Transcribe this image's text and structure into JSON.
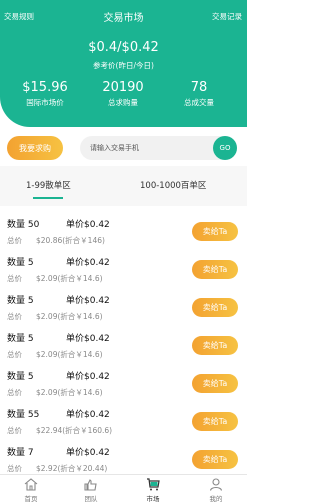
{
  "header": {
    "rules_link": "交易规则",
    "title": "交易市场",
    "records_link": "交易记录",
    "price": "$0.4/$0.42",
    "price_caption": "参考价(昨日/今日)",
    "stats": [
      {
        "value": "$15.96",
        "label": "国际市场价"
      },
      {
        "value": "20190",
        "label": "总求购量"
      },
      {
        "value": "78",
        "label": "总成交量"
      }
    ]
  },
  "search": {
    "buy_button": "我要求购",
    "placeholder": "请输入交易手机",
    "go_button": "GO"
  },
  "tabs": [
    {
      "label": "1-99散单区",
      "active": true
    },
    {
      "label": "100-1000百单区",
      "active": false
    }
  ],
  "listings": [
    {
      "qty": "数量 50",
      "unit": "单价$0.42",
      "total_label": "总价",
      "total": "$20.86(折合￥146)",
      "action": "卖给Ta"
    },
    {
      "qty": "数量 5",
      "unit": "单价$0.42",
      "total_label": "总价",
      "total": "$2.09(折合￥14.6)",
      "action": "卖给Ta"
    },
    {
      "qty": "数量 5",
      "unit": "单价$0.42",
      "total_label": "总价",
      "total": "$2.09(折合￥14.6)",
      "action": "卖给Ta"
    },
    {
      "qty": "数量 5",
      "unit": "单价$0.42",
      "total_label": "总价",
      "total": "$2.09(折合￥14.6)",
      "action": "卖给Ta"
    },
    {
      "qty": "数量 5",
      "unit": "单价$0.42",
      "total_label": "总价",
      "total": "$2.09(折合￥14.6)",
      "action": "卖给Ta"
    },
    {
      "qty": "数量 55",
      "unit": "单价$0.42",
      "total_label": "总价",
      "total": "$22.94(折合￥160.6)",
      "action": "卖给Ta"
    },
    {
      "qty": "数量 7",
      "unit": "单价$0.42",
      "total_label": "总价",
      "total": "$2.92(折合￥20.44)",
      "action": "卖给Ta"
    }
  ],
  "bottom_nav": [
    {
      "label": "首页",
      "icon": "home-icon"
    },
    {
      "label": "团队",
      "icon": "team-icon"
    },
    {
      "label": "市场",
      "icon": "market-icon",
      "active": true
    },
    {
      "label": "我的",
      "icon": "profile-icon"
    }
  ],
  "colors": {
    "primary": "#1bb492",
    "accent": "#f3a231"
  }
}
